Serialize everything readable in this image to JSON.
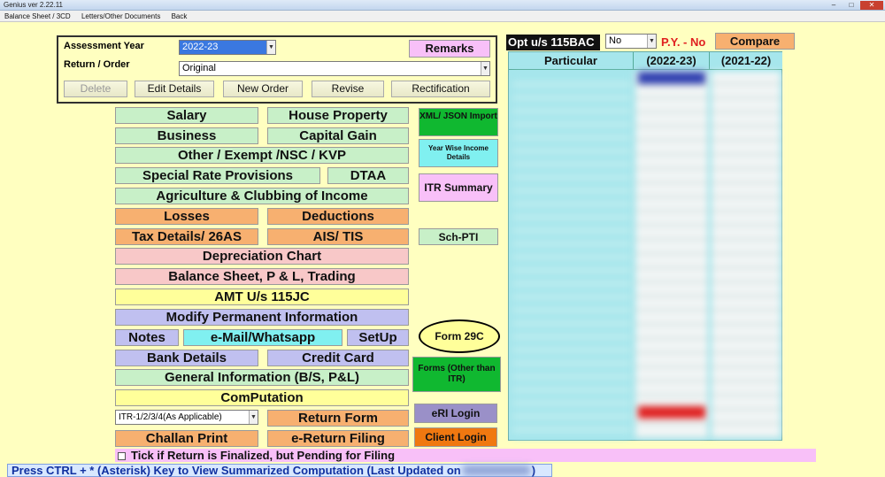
{
  "window": {
    "title": "Genius ver 2.22.11",
    "controls": [
      "–",
      "□",
      "✕"
    ]
  },
  "menu": [
    "Balance Sheet / 3CD",
    "Letters/Other Documents",
    "Back"
  ],
  "assessment": {
    "ay_label": "Assessment Year",
    "ay_value": "2022-23",
    "ro_label": "Return / Order",
    "ro_value": "Original",
    "remarks": "Remarks",
    "buttons": [
      "Delete",
      "Edit Details",
      "New Order",
      "Revise",
      "Rectification"
    ]
  },
  "heads": {
    "salary": "Salary",
    "house": "House Property",
    "business": "Business",
    "capgain": "Capital Gain",
    "other": "Other / Exempt /NSC / KVP",
    "special": "Special Rate Provisions",
    "dtaa": "DTAA",
    "agri": "Agriculture & Clubbing of Income",
    "losses": "Losses",
    "deductions": "Deductions",
    "tax": "Tax Details/ 26AS",
    "ais": "AIS/ TIS",
    "dep": "Depreciation Chart",
    "bs": "Balance Sheet, P & L, Trading",
    "amt": "AMT U/s 115JC",
    "modify": "Modify Permanent Information",
    "notes": "Notes",
    "email": "e-Mail/Whatsapp",
    "setup": "SetUp",
    "bank": "Bank Details",
    "credit": "Credit Card",
    "general": "General Information (B/S, P&L)",
    "comp": "ComPutation",
    "itr_select": "ITR-1/2/3/4(As Applicable)",
    "return_form": "Return Form",
    "challan": "Challan Print",
    "ereturn": "e-Return Filing"
  },
  "side": {
    "xml": "XML/ JSON Import",
    "yearwise": "Year Wise Income Details",
    "itr_summary": "ITR Summary",
    "schpti": "Sch-PTI",
    "form29c": "Form 29C",
    "forms_other": "Forms (Other than ITR)",
    "eri": "eRI Login",
    "client": "Client Login"
  },
  "opt": {
    "label": "Opt u/s 115BAC",
    "value": "No",
    "py": "P.Y. - No",
    "compare": "Compare"
  },
  "grid": {
    "headers": [
      "Particular",
      "(2022-23)",
      "(2021-22)"
    ]
  },
  "finalized_note": "Tick if Return is Finalized, but Pending for Filing",
  "status": "Press CTRL + * (Asterisk) Key to View Summarized Computation (Last Updated on",
  "status_end": ")",
  "colors": {
    "highlight_circle": "#000000",
    "grid_bg": "#a6e6ec",
    "accent_blue": "#3a78e0"
  }
}
